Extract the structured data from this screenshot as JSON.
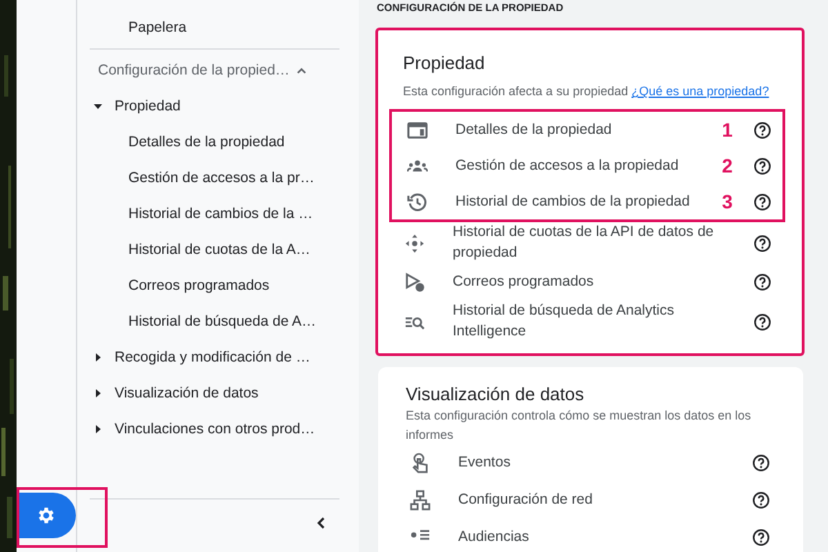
{
  "sidebar": {
    "top_item": "Papelera",
    "section": {
      "label": "Configuración de la propied…",
      "expanded": true,
      "groups": [
        {
          "label": "Propiedad",
          "expanded": true,
          "children": [
            {
              "label": "Detalles de la propiedad"
            },
            {
              "label": "Gestión de accesos a la pr…"
            },
            {
              "label": "Historial de cambios de la …"
            },
            {
              "label": "Historial de cuotas de la A…"
            },
            {
              "label": "Correos programados"
            },
            {
              "label": "Historial de búsqueda de A…"
            }
          ]
        },
        {
          "label": "Recogida y modificación de …",
          "expanded": false
        },
        {
          "label": "Visualización de datos",
          "expanded": false
        },
        {
          "label": "Vinculaciones con otros prod…",
          "expanded": false
        }
      ]
    },
    "settings_button": {
      "highlighted": true
    }
  },
  "main": {
    "heading": "CONFIGURACIÓN DE LA PROPIEDAD",
    "cards": [
      {
        "title": "Propiedad",
        "description": "Esta configuración afecta a su propiedad",
        "link": "¿Qué es una propiedad?",
        "highlighted": true,
        "highlight_rows": [
          {
            "kind": "details",
            "label": "Detalles de la propiedad",
            "marker": "1"
          },
          {
            "kind": "people",
            "label": "Gestión de accesos a la propiedad",
            "marker": "2"
          },
          {
            "kind": "history",
            "label": "Historial de cambios de la propiedad",
            "marker": "3"
          }
        ],
        "rows": [
          {
            "kind": "api",
            "label": "Historial de cuotas de la API de datos de propiedad"
          },
          {
            "kind": "schedule",
            "label": "Correos programados"
          },
          {
            "kind": "search",
            "label": "Historial de búsqueda de Analytics Intelligence"
          }
        ]
      },
      {
        "title": "Visualización de datos",
        "description": "Esta configuración controla cómo se muestran los datos en los informes",
        "highlighted": false,
        "rows": [
          {
            "kind": "events",
            "label": "Eventos"
          },
          {
            "kind": "network",
            "label": "Configuración de red"
          },
          {
            "kind": "audience",
            "label": "Audiencias"
          }
        ]
      }
    ]
  }
}
